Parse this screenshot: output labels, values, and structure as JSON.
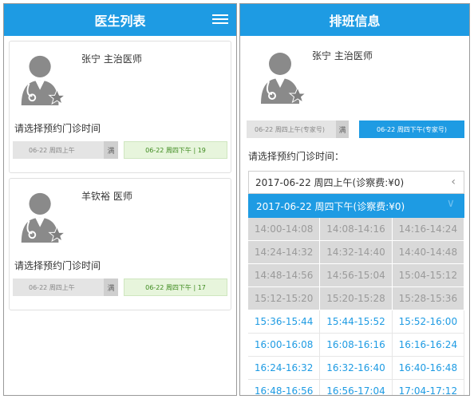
{
  "left": {
    "title": "医生列表",
    "doctors": [
      {
        "name": "张宁  主治医师",
        "prompt": "请选择预约门诊时间",
        "am_label": "06-22 周四上午",
        "am_status": "满",
        "pm_label": "06-22 周四下午 | 19"
      },
      {
        "name": "羊钦裕  医师",
        "prompt": "请选择预约门诊时间",
        "am_label": "06-22 周四上午",
        "am_status": "满",
        "pm_label": "06-22 周四下午 | 17"
      }
    ]
  },
  "right": {
    "title": "排班信息",
    "doctor_name": "张宁  主治医师",
    "am_label": "06-22 周四上午(专家号)",
    "am_status": "满",
    "pm_label": "06-22 周四下午(专家号)",
    "prompt": "请选择预约门诊时间：",
    "select_value": "2017-06-22 周四上午(诊察费:¥0)",
    "option_highlighted": "2017-06-22 周四下午(诊察费:¥0)",
    "slots": [
      {
        "t": "14:00-14:08",
        "available": false
      },
      {
        "t": "14:08-14:16",
        "available": false
      },
      {
        "t": "14:16-14:24",
        "available": false
      },
      {
        "t": "14:24-14:32",
        "available": false
      },
      {
        "t": "14:32-14:40",
        "available": false
      },
      {
        "t": "14:40-14:48",
        "available": false
      },
      {
        "t": "14:48-14:56",
        "available": false
      },
      {
        "t": "14:56-15:04",
        "available": false
      },
      {
        "t": "15:04-15:12",
        "available": false
      },
      {
        "t": "15:12-15:20",
        "available": false
      },
      {
        "t": "15:20-15:28",
        "available": false
      },
      {
        "t": "15:28-15:36",
        "available": false
      },
      {
        "t": "15:36-15:44",
        "available": true
      },
      {
        "t": "15:44-15:52",
        "available": true
      },
      {
        "t": "15:52-16:00",
        "available": true
      },
      {
        "t": "16:00-16:08",
        "available": true
      },
      {
        "t": "16:08-16:16",
        "available": true
      },
      {
        "t": "16:16-16:24",
        "available": true
      },
      {
        "t": "16:24-16:32",
        "available": true
      },
      {
        "t": "16:32-16:40",
        "available": true
      },
      {
        "t": "16:40-16:48",
        "available": true
      },
      {
        "t": "16:48-16:56",
        "available": true
      },
      {
        "t": "16:56-17:04",
        "available": true
      },
      {
        "t": "17:04-17:12",
        "available": true
      }
    ]
  },
  "colors": {
    "accent": "#1e9be3",
    "available_green": "#3d8a1e",
    "disabled_grey": "#d9d9d9"
  },
  "icons": {
    "menu": "hamburger-icon",
    "avatar": "doctor-avatar-icon",
    "chevron": "chevron-left-icon"
  }
}
